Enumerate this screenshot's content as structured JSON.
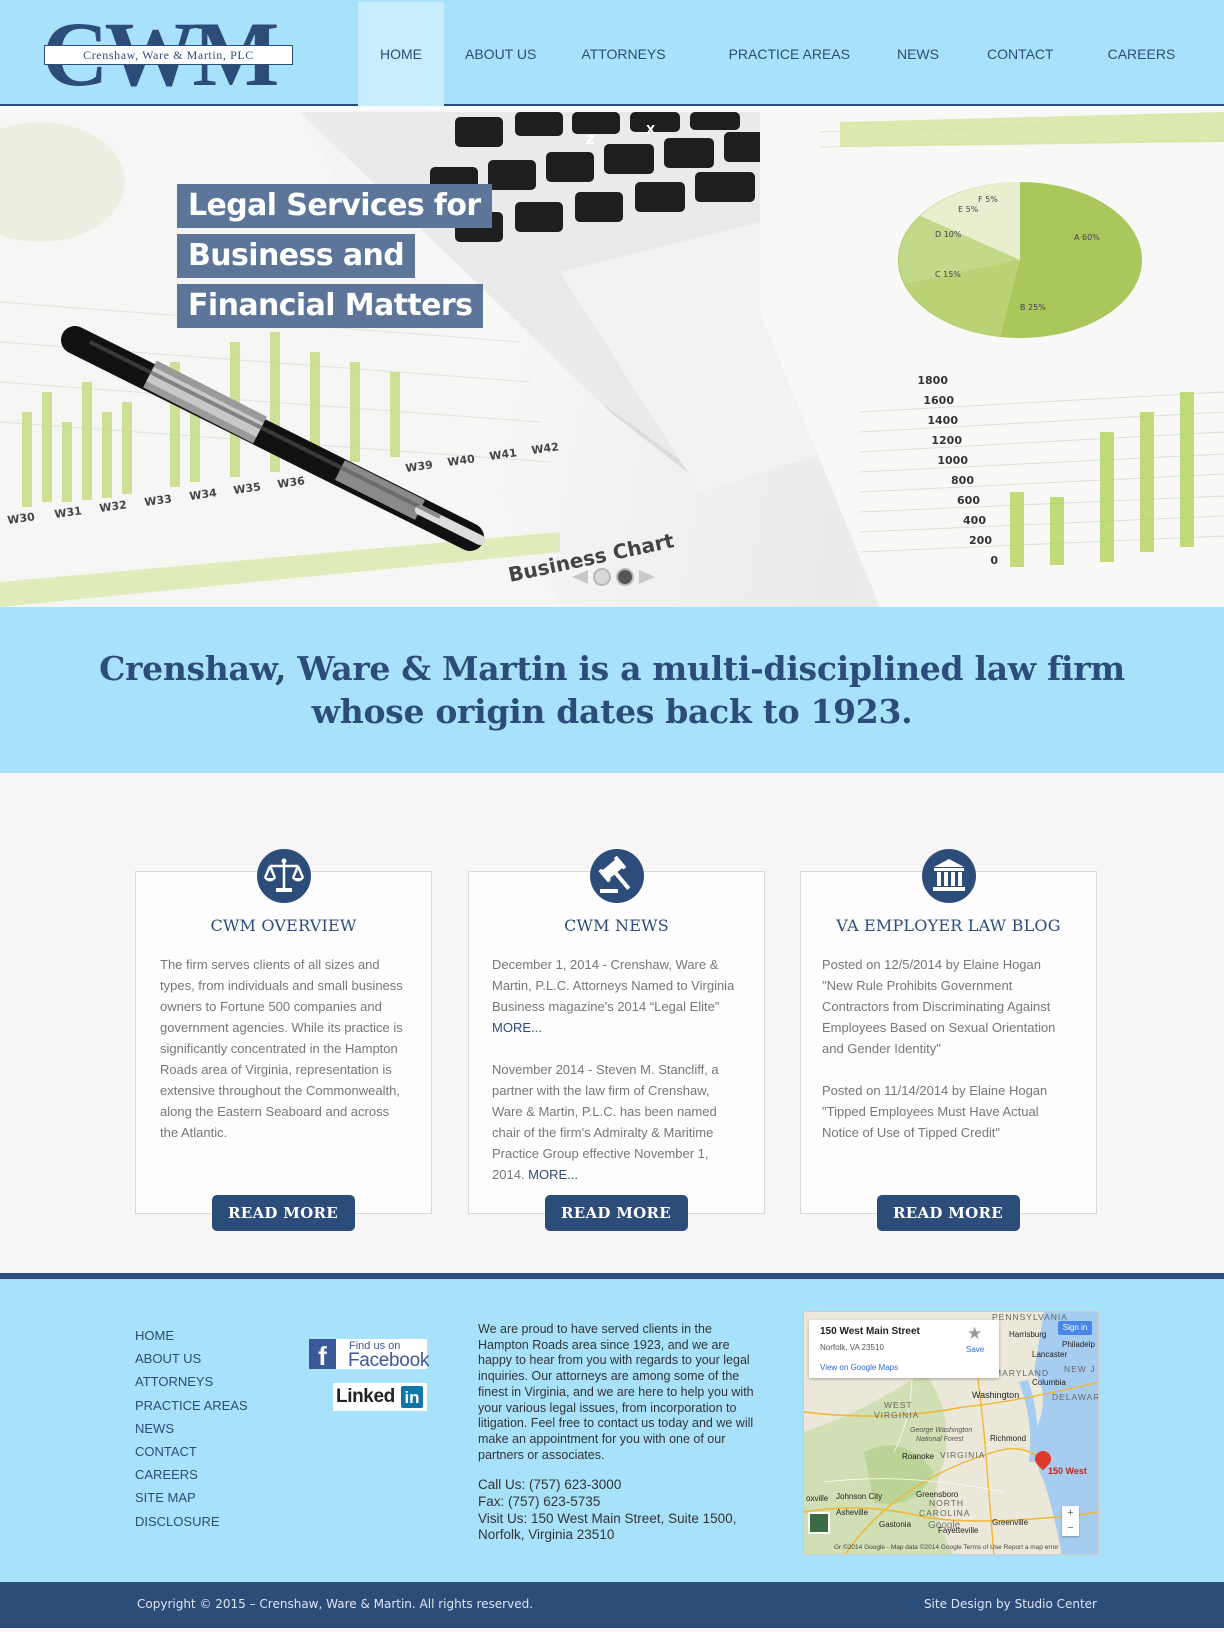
{
  "header": {
    "logo": {
      "big_text": "CWM",
      "firm_text": "Crenshaw, Ware & Martin, PLC",
      "amp": "&"
    },
    "nav": [
      {
        "label": "HOME",
        "active": true
      },
      {
        "label": "ABOUT US"
      },
      {
        "label": "ATTORNEYS"
      },
      {
        "label": "PRACTICE AREAS"
      },
      {
        "label": "NEWS"
      },
      {
        "label": "CONTACT"
      },
      {
        "label": "CAREERS"
      }
    ]
  },
  "hero": {
    "lines": [
      "Legal Services for",
      "Business and",
      "Financial Matters"
    ],
    "image_text": {
      "chart_caption": "Business Chart",
      "week_labels": [
        "W30",
        "W31",
        "W32",
        "W33",
        "W34",
        "W35",
        "W36",
        "W39",
        "W40",
        "W41",
        "W42"
      ],
      "y_ticks": [
        "1800",
        "1600",
        "1400",
        "1200",
        "1000",
        "800",
        "600",
        "400",
        "200",
        "0"
      ],
      "pie_labels": [
        "A 60%",
        "B 25%",
        "C 15%",
        "D 10%",
        "E 5%",
        "F 5%"
      ],
      "keys": [
        "Z",
        "X"
      ]
    },
    "slider": {
      "slide_count": 2,
      "active_index": 1
    }
  },
  "tagline": "Crenshaw, Ware & Martin is a multi-disciplined law firm whose origin dates back to 1923.",
  "cards": [
    {
      "icon": "scales-of-justice-icon",
      "title": "CWM OVERVIEW",
      "paragraphs": [
        "The firm serves clients of all sizes and types, from individuals and small business owners to Fortune 500 companies and government agencies.  While its practice is significantly concentrated in the Hampton Roads area of Virginia, representation is extensive throughout the Commonwealth, along the Eastern Seaboard and across the Atlantic."
      ],
      "button": "READ MORE"
    },
    {
      "icon": "gavel-icon",
      "title": "CWM NEWS",
      "items": [
        {
          "text": "December 1, 2014 - Crenshaw, Ware & Martin, P.L.C. Attorneys Named to Virginia Business magazine's 2014 “Legal Elite”",
          "more": "MORE..."
        },
        {
          "text": "November 2014 - Steven M. Stancliff, a partner with the law firm of Crenshaw, Ware & Martin, P.L.C. has been named chair of the firm's Admiralty & Maritime Practice Group effective November 1, 2014.",
          "more": "MORE..."
        }
      ],
      "button": "READ MORE"
    },
    {
      "icon": "courthouse-icon",
      "title": "VA EMPLOYER LAW BLOG",
      "posts": [
        {
          "meta": "Posted on 12/5/2014 by Elaine Hogan",
          "title": "\"New Rule Prohibits Government Contractors from Discriminating Against Employees Based on Sexual Orientation and Gender Identity\""
        },
        {
          "meta": "Posted on 11/14/2014 by Elaine Hogan",
          "title": "\"Tipped Employees Must Have Actual Notice of Use of Tipped Credit\""
        }
      ],
      "button": "READ MORE"
    }
  ],
  "footer": {
    "links": [
      "HOME",
      "ABOUT US",
      "ATTORNEYS",
      "PRACTICE AREAS",
      "NEWS",
      "CONTACT",
      "CAREERS",
      "SITE MAP",
      "DISCLOSURE"
    ],
    "facebook": {
      "line1": "Find us on",
      "line2": "Facebook"
    },
    "linkedin": {
      "text": "Linked",
      "in": "in"
    },
    "about": "We are proud to have served clients in the Hampton Roads area since 1923, and we are happy to hear from you with regards to your legal inquiries. Our attorneys are among some of the finest in Virginia, and we are here to help you with your various legal issues, from incorporation to litigation. Feel free to contact us today and we will make an appointment for you with one of our partners or associates.",
    "contact": {
      "call": "Call Us: (757) 623-3000",
      "fax": "Fax: (757) 623-5735",
      "visit_line1": "Visit Us: 150 West Main Street, Suite 1500,",
      "visit_line2": "Norfolk, Virginia 23510"
    },
    "map": {
      "place_title": "150 West Main Street",
      "place_address": "Norfolk, VA 23510",
      "view_link": "View on Google Maps",
      "save_label": "Save",
      "signin_label": "Sign in",
      "pin_label": "150 West",
      "zoom_in": "+",
      "zoom_out": "−",
      "footer_text": "Gr ©2014 Google - Map data ©2014 Google   Terms of Use   Report a map error",
      "labels": {
        "pennsylvania": "PENNSYLVANIA",
        "harrisburg": "Harrisburg",
        "philadelphia": "Philadelp",
        "lancaster": "Lancaster",
        "maryland": "MARYLAND",
        "new_jersey": "NEW J",
        "columbia": "Columbia",
        "washington": "Washington",
        "delaware": "DELAWAR",
        "west_virginia_1": "WEST",
        "west_virginia_2": "VIRGINIA",
        "george_washington_1": "George Washington",
        "george_washington_2": "National Forest",
        "richmond": "Richmond",
        "roanoke": "Roanoke",
        "virginia": "VIRGINIA",
        "johnson_city": "Johnson City",
        "greensboro": "Greensboro",
        "asheville": "Asheville",
        "north_carolina_1": "NORTH",
        "north_carolina_2": "CAROLINA",
        "gastonia": "Gastonia",
        "fayetteville": "Fayetteville",
        "greenville": "Greenville",
        "knoxville": "oxville",
        "google": "Google"
      }
    }
  },
  "bottom_bar": {
    "copyright": "Copyright © 2015 – Crenshaw, Ware & Martin. All rights reserved.",
    "credit": "Site Design by Studio Center"
  },
  "colors": {
    "light_blue": "#a8e2fa",
    "navy": "#2c4c79",
    "hero_label_bg": "#5d7598",
    "chart_green": "#b6d35a"
  }
}
